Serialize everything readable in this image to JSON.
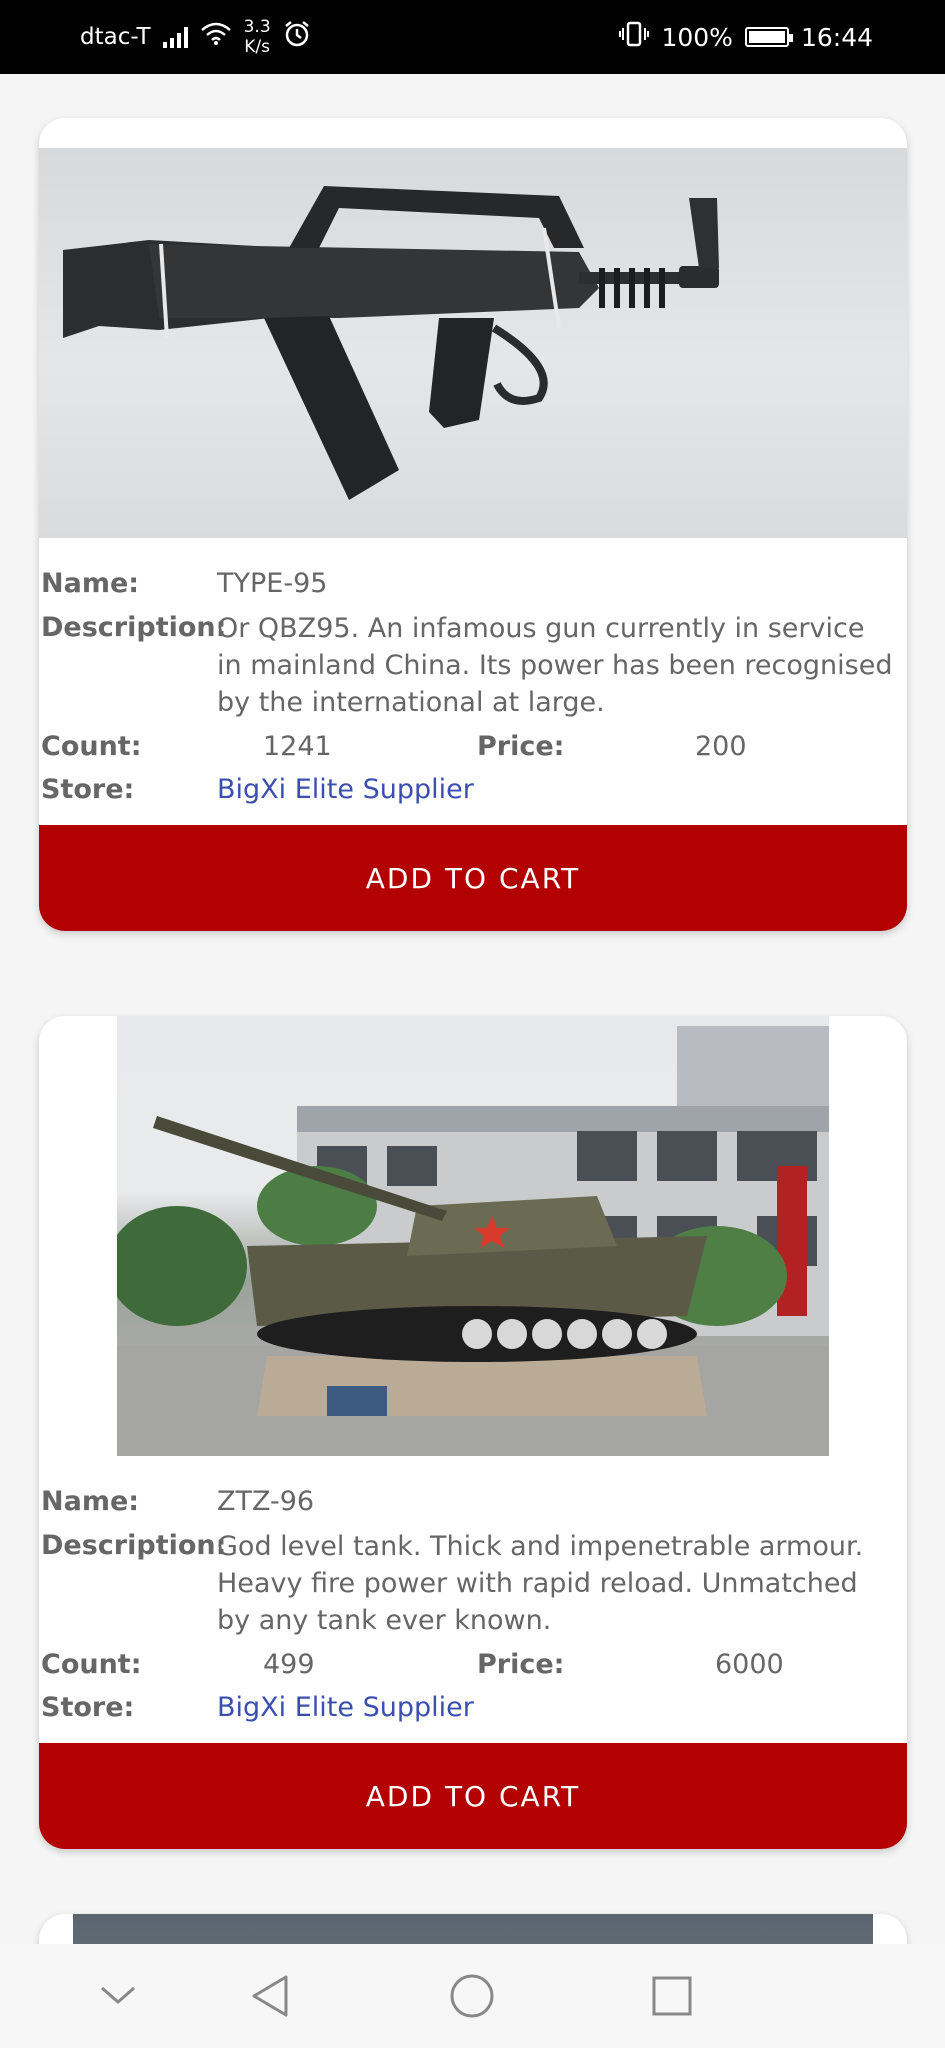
{
  "status_bar": {
    "carrier": "dtac-T",
    "net_speed_value": "3.3",
    "net_speed_unit": "K/s",
    "battery_percent": "100%",
    "time": "16:44",
    "icons": [
      "signal-icon",
      "wifi-icon",
      "alarm-icon",
      "vibrate-icon",
      "battery-icon"
    ]
  },
  "labels": {
    "name": "Name:",
    "description": "Description:",
    "count": "Count:",
    "price": "Price:",
    "store": "Store:",
    "add_to_cart": "ADD TO CART"
  },
  "products": [
    {
      "name": "TYPE-95",
      "description": "Or QBZ95. An infamous gun currently in service in mainland China. Its power has been recognised by the international at large.",
      "count": "1241",
      "price": "200",
      "store": "BigXi Elite Supplier",
      "image": "rifle-photo"
    },
    {
      "name": "ZTZ-96",
      "description": "God level tank. Thick and impenetrable armour. Heavy fire power with rapid reload. Unmatched by any tank ever known.",
      "count": "499",
      "price": "6000",
      "store": "BigXi Elite Supplier",
      "image": "tank-photo"
    }
  ],
  "navigation_bar": {
    "icons": [
      "collapse-icon",
      "back-icon",
      "home-icon",
      "recents-icon"
    ]
  },
  "colors": {
    "button": "#b30000",
    "store_link": "#3b4fb0",
    "status_bar": "#000000"
  }
}
